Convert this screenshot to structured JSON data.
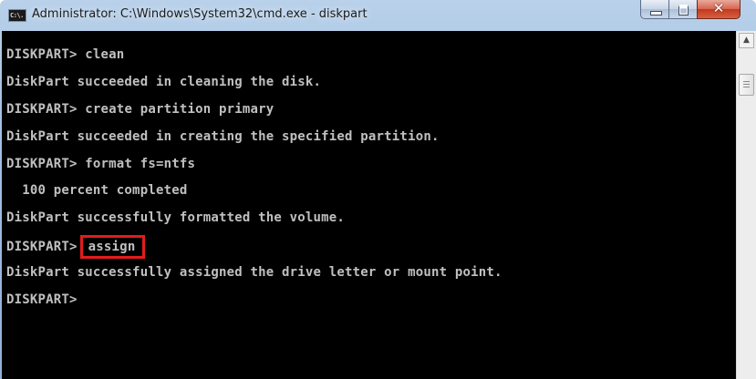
{
  "window": {
    "title": "Administrator: C:\\Windows\\System32\\cmd.exe - diskpart",
    "icon_label": "C:\\."
  },
  "controls": {
    "close_glyph": "✕"
  },
  "scrollbar": {
    "up_arrow": "▲"
  },
  "console": {
    "lines": [
      {
        "prompt": "DISKPART> ",
        "command": "clean"
      },
      {
        "output": "DiskPart succeeded in cleaning the disk."
      },
      {
        "prompt": "DISKPART> ",
        "command": "create partition primary"
      },
      {
        "output": "DiskPart succeeded in creating the specified partition."
      },
      {
        "prompt": "DISKPART> ",
        "command": "format fs=ntfs"
      },
      {
        "output": "  100 percent completed"
      },
      {
        "output": "DiskPart successfully formatted the volume."
      },
      {
        "prompt": "DISKPART>",
        "command": "assign",
        "highlighted": true
      },
      {
        "output": "DiskPart successfully assigned the drive letter or mount point."
      },
      {
        "prompt": "DISKPART>",
        "command": ""
      }
    ]
  },
  "colors": {
    "console_background": "#000000",
    "console_text": "#c0c0c0",
    "highlight_border": "#e31b1b"
  }
}
